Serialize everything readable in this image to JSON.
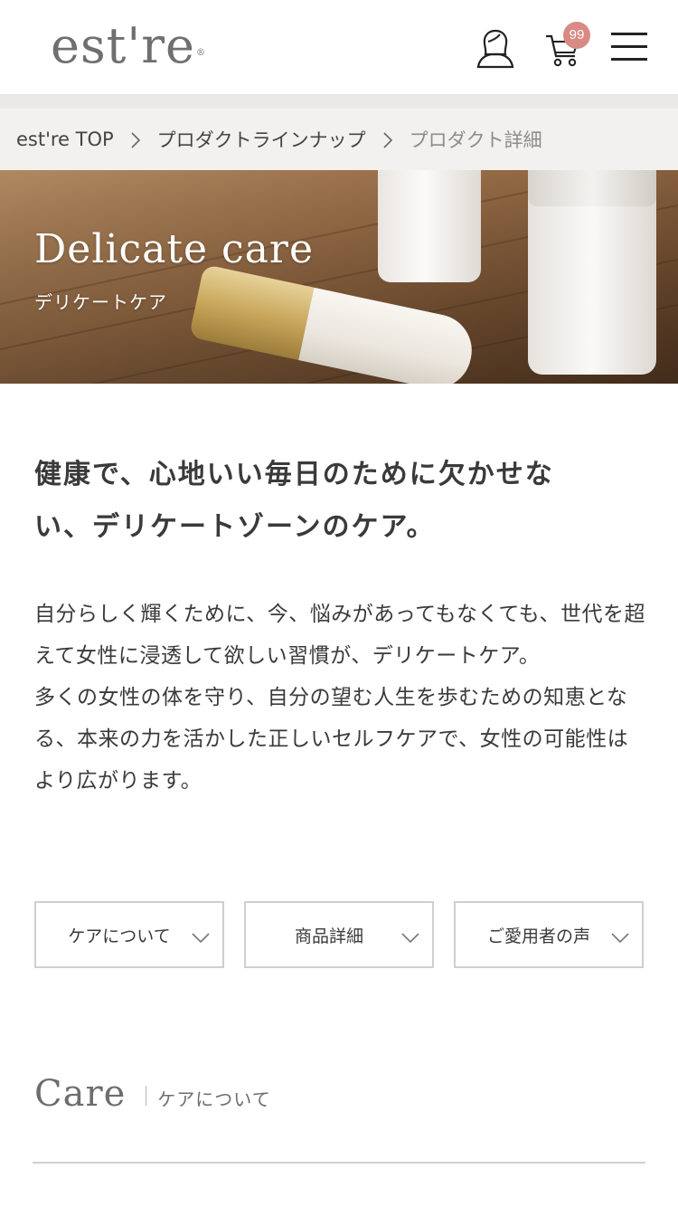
{
  "header": {
    "logo": "est're",
    "logo_mark": "®",
    "cart_count": "99"
  },
  "breadcrumb": {
    "items": [
      "est're TOP",
      "プロダクトラインナップ",
      "プロダクト詳細"
    ]
  },
  "hero": {
    "title": "Delicate care",
    "subtitle": "デリケートケア"
  },
  "main": {
    "lead_line1": "健康で、心地いい毎日のために欠かせな",
    "lead_line2": "い、デリケートゾーンのケア。",
    "paragraph1": "自分らしく輝くために、今、悩みがあってもなくても、世代を超えて女性に浸透して欲しい習慣が、デリケートケア。",
    "paragraph2": "多くの女性の体を守り、自分の望む人生を歩むための知恵となる、本来の力を活かした正しいセルフケアで、女性の可能性はより広がります。"
  },
  "anchors": [
    "ケアについて",
    "商品詳細",
    "ご愛用者の声"
  ],
  "section": {
    "title": "Care",
    "subtitle": "ケアについて"
  },
  "colors": {
    "badge": "#d98a85",
    "breadcrumb_bg": "#f3f1ef",
    "text": "#3a3a3a"
  }
}
